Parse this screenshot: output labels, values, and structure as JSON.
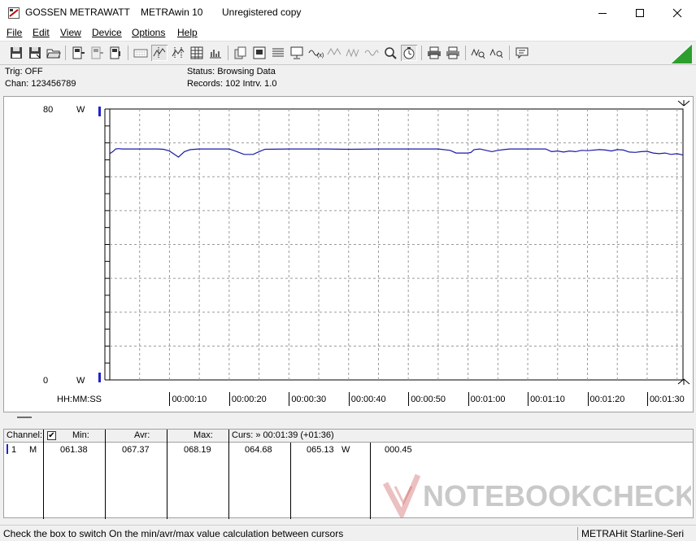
{
  "window": {
    "title_brand": "GOSSEN METRAWATT",
    "title_app": "METRAwin 10",
    "title_status": "Unregistered copy"
  },
  "menu": [
    {
      "label": "File"
    },
    {
      "label": "Edit"
    },
    {
      "label": "View"
    },
    {
      "label": "Device"
    },
    {
      "label": "Options"
    },
    {
      "label": "Help"
    }
  ],
  "toolbar_icons": [
    "save-icon",
    "save-as-icon",
    "open-icon",
    "device-connect-icon",
    "device-disconnect-icon",
    "device-settings-icon",
    "keyboard-icon",
    "cursor-icon",
    "zoom-icon",
    "table-icon",
    "bar-chart-icon",
    "copy-icon",
    "print-preview-icon",
    "list-icon",
    "monitor-icon",
    "wave-icon",
    "triangle-wave-icon",
    "sine-wave-icon",
    "magnify-icon",
    "stopwatch-icon",
    "printer-icon",
    "print-setup-icon",
    "measure-icon",
    "measure-query-icon",
    "comment-icon"
  ],
  "info": {
    "trig": "Trig: OFF",
    "chan": "Chan:  123456789",
    "status": "Status:    Browsing Data",
    "records": "Records: 102   Intrv. 1.0"
  },
  "chart_data": {
    "type": "line",
    "ylim": [
      0,
      80
    ],
    "y_top_label": "80",
    "y_bottom_label": "0",
    "y_unit_top": "W",
    "y_unit_bottom": "W",
    "x_axis_label": "HH:MM:SS",
    "x_tick_labels": [
      "00:00:10",
      "00:00:20",
      "00:00:30",
      "00:00:40",
      "00:00:50",
      "00:01:00",
      "00:01:10",
      "00:01:20",
      "00:01:30"
    ],
    "x_ticks_seconds": [
      10,
      20,
      30,
      40,
      50,
      60,
      70,
      80,
      90
    ],
    "xlim": [
      0,
      96
    ],
    "grid": true,
    "series": [
      {
        "color": "#1a1aa8",
        "points": [
          [
            0,
            66.8
          ],
          [
            0.5,
            67.4
          ],
          [
            1,
            68.2
          ],
          [
            1.5,
            68.3
          ],
          [
            2,
            68.2
          ],
          [
            3,
            68.2
          ],
          [
            4,
            68.2
          ],
          [
            5,
            68.2
          ],
          [
            6,
            68.2
          ],
          [
            7,
            68.2
          ],
          [
            8,
            68.2
          ],
          [
            9,
            68.1
          ],
          [
            10,
            67.6
          ],
          [
            11.5,
            65.8
          ],
          [
            12.5,
            67.4
          ],
          [
            13.5,
            68.0
          ],
          [
            15,
            68.2
          ],
          [
            17,
            68.2
          ],
          [
            20,
            68.2
          ],
          [
            21,
            67.6
          ],
          [
            22.5,
            66.6
          ],
          [
            24,
            66.6
          ],
          [
            25,
            67.4
          ],
          [
            26,
            68.1
          ],
          [
            30,
            68.2
          ],
          [
            36,
            68.2
          ],
          [
            40,
            68.1
          ],
          [
            45,
            68.2
          ],
          [
            50,
            68.2
          ],
          [
            55,
            68.2
          ],
          [
            57,
            67.8
          ],
          [
            58,
            67.0
          ],
          [
            60,
            67.0
          ],
          [
            60.5,
            67.2
          ],
          [
            61,
            68.0
          ],
          [
            62,
            68.2
          ],
          [
            63,
            67.8
          ],
          [
            64,
            67.4
          ],
          [
            65,
            67.8
          ],
          [
            66,
            68.0
          ],
          [
            67,
            68.2
          ],
          [
            69,
            68.2
          ],
          [
            73,
            68.2
          ],
          [
            74,
            67.4
          ],
          [
            75,
            67.6
          ],
          [
            76,
            67.3
          ],
          [
            77,
            67.6
          ],
          [
            78,
            67.4
          ],
          [
            79,
            67.8
          ],
          [
            80,
            67.7
          ],
          [
            82,
            68.0
          ],
          [
            83,
            67.9
          ],
          [
            84,
            67.6
          ],
          [
            85,
            68.0
          ],
          [
            86,
            67.9
          ],
          [
            87,
            67.3
          ],
          [
            88,
            67.2
          ],
          [
            89,
            67.4
          ],
          [
            90,
            67.5
          ],
          [
            91,
            67.0
          ],
          [
            92,
            66.8
          ],
          [
            93,
            67.0
          ],
          [
            94,
            66.6
          ],
          [
            95,
            66.8
          ],
          [
            96,
            66.4
          ]
        ]
      }
    ]
  },
  "table": {
    "headers": {
      "channel": "Channel:",
      "min": "Min:",
      "avr": "Avr:",
      "max": "Max:",
      "curs": "Curs: » 00:01:39 (+01:36)"
    },
    "checkbox_checked": true,
    "row": {
      "channel_no": "1",
      "mode": "M",
      "min": "061.38",
      "avr": "067.37",
      "max": "068.19",
      "c1": "064.68",
      "c2": "065.13",
      "unit": "W",
      "delta": "000.45"
    }
  },
  "status": {
    "left": "Check the box to switch On the min/avr/max value calculation between cursors",
    "right": "METRAHit Starline-Seri"
  },
  "watermark": {
    "text": "NOTEBOOKCHECK"
  }
}
